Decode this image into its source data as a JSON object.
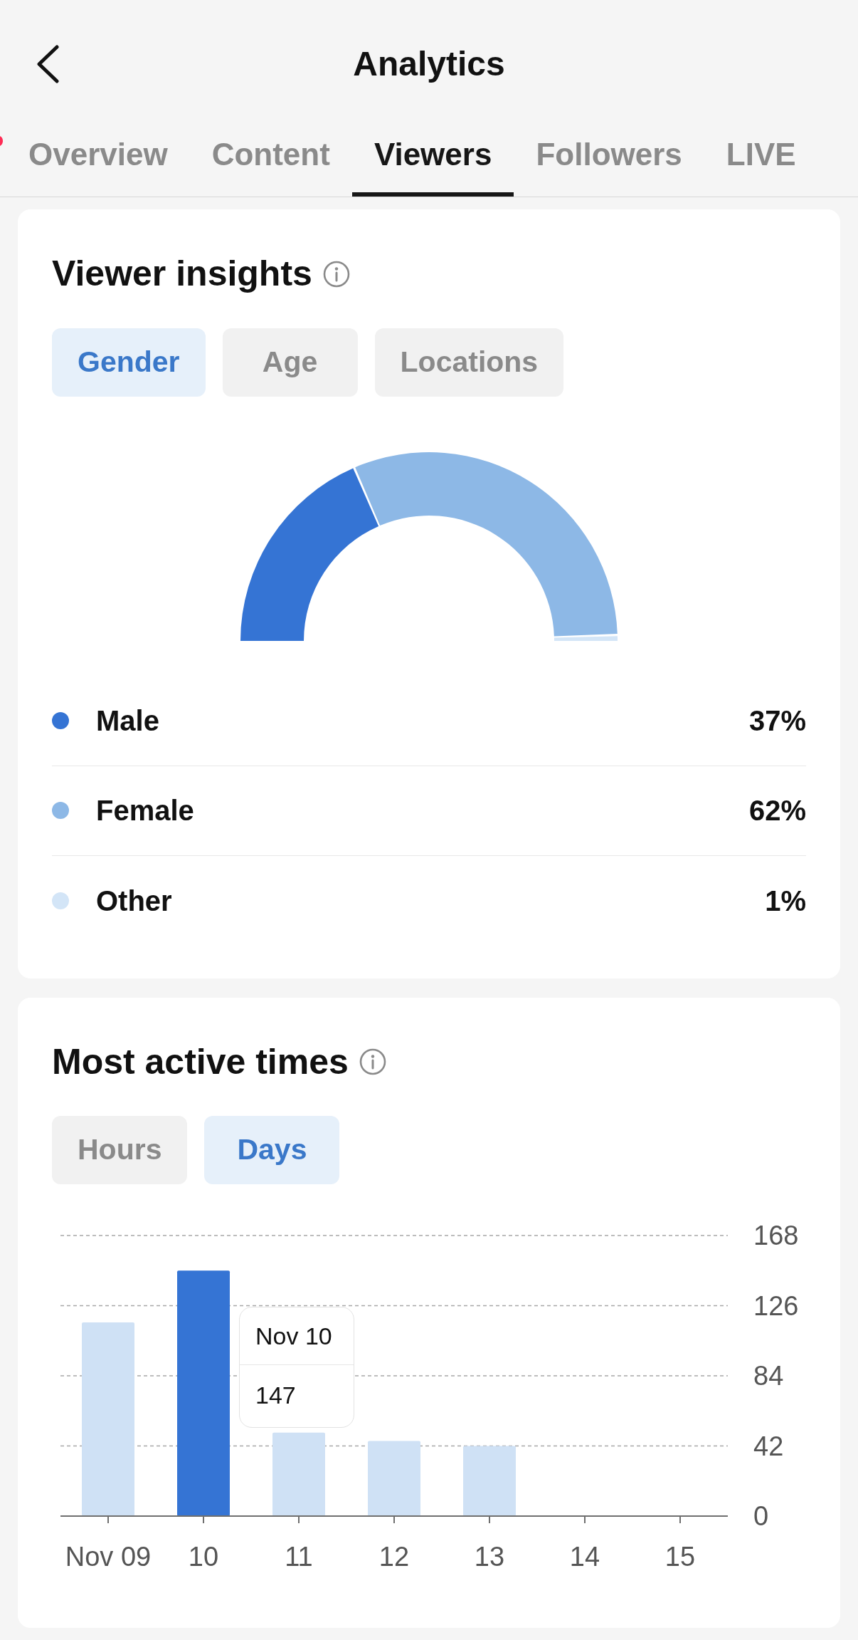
{
  "header": {
    "title": "Analytics"
  },
  "tabs": [
    {
      "label": "Overview",
      "selected": false
    },
    {
      "label": "Content",
      "selected": false
    },
    {
      "label": "Viewers",
      "selected": true
    },
    {
      "label": "Followers",
      "selected": false
    },
    {
      "label": "LIVE",
      "selected": false
    }
  ],
  "viewer_insights": {
    "title": "Viewer insights",
    "filters": [
      {
        "label": "Gender",
        "selected": true
      },
      {
        "label": "Age",
        "selected": false
      },
      {
        "label": "Locations",
        "selected": false
      }
    ],
    "chart_data": {
      "type": "donut",
      "values": [
        37,
        62,
        1
      ]
    },
    "legend": [
      {
        "label": "Male",
        "value": "37%",
        "color": "#3574d4"
      },
      {
        "label": "Female",
        "value": "62%",
        "color": "#8db8e6"
      },
      {
        "label": "Other",
        "value": "1%",
        "color": "#d3e5f7"
      }
    ]
  },
  "active_times": {
    "title": "Most active times",
    "filters": [
      {
        "label": "Hours",
        "selected": false
      },
      {
        "label": "Days",
        "selected": true
      }
    ],
    "chart_data": {
      "type": "bar",
      "categories": [
        "Nov 09",
        "10",
        "11",
        "12",
        "13",
        "14",
        "15"
      ],
      "values": [
        116,
        147,
        50,
        45,
        42,
        null,
        null
      ],
      "ylim": [
        0,
        168
      ],
      "yticks": [
        0,
        42,
        84,
        126,
        168
      ],
      "grid": true
    },
    "bars": [
      {
        "selected": false
      },
      {
        "selected": true
      },
      {
        "selected": false
      },
      {
        "selected": false
      },
      {
        "selected": false
      }
    ],
    "tooltip": {
      "title": "Nov 10",
      "value": "147"
    }
  }
}
